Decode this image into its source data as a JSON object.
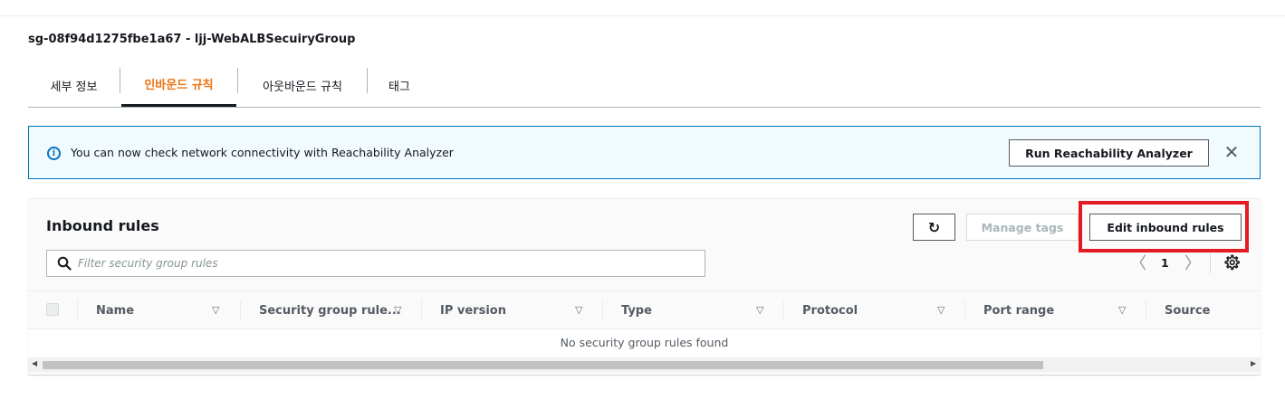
{
  "security_group": {
    "title": "sg-08f94d1275fbe1a67 - ljj-WebALBSecuiryGroup"
  },
  "tabs": [
    {
      "label": "세부 정보",
      "active": false
    },
    {
      "label": "인바운드 규칙",
      "active": true
    },
    {
      "label": "아웃바운드 규칙",
      "active": false
    },
    {
      "label": "태그",
      "active": false
    }
  ],
  "banner": {
    "icon": "info-icon",
    "message": "You can now check network connectivity with Reachability Analyzer",
    "button_label": "Run Reachability Analyzer",
    "close_glyph": "✕"
  },
  "panel": {
    "title": "Inbound rules",
    "refresh_glyph": "↻",
    "manage_tags_label": "Manage tags",
    "edit_rules_label": "Edit inbound rules",
    "search_placeholder": "Filter security group rules",
    "pagination": {
      "prev": "〈",
      "page": "1",
      "next": "〉"
    }
  },
  "table": {
    "columns": [
      {
        "label": "Name"
      },
      {
        "label": "Security group rule..."
      },
      {
        "label": "IP version"
      },
      {
        "label": "Type"
      },
      {
        "label": "Protocol"
      },
      {
        "label": "Port range"
      },
      {
        "label": "Source"
      }
    ],
    "sort_glyph": "▽",
    "empty_message": "No security group rules found"
  },
  "scrollbar": {
    "left_arrow": "◀",
    "right_arrow": "▶"
  },
  "colors": {
    "active_tab": "#ec7211",
    "info_blue": "#0073bb",
    "highlight_red": "#e41b23"
  }
}
